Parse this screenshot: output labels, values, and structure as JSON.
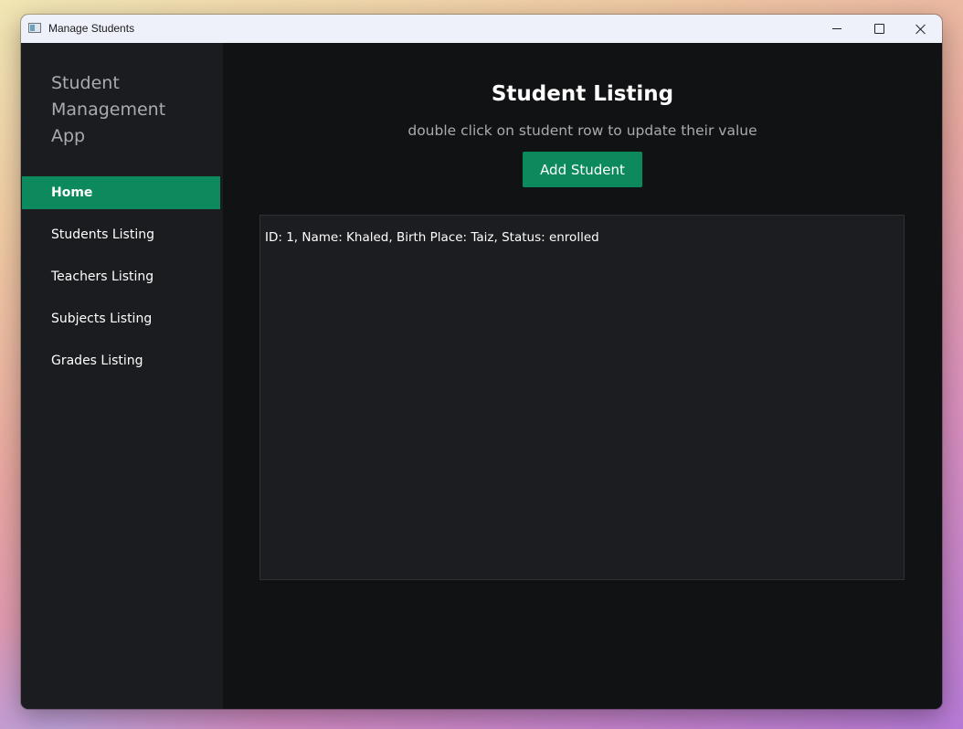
{
  "window": {
    "title": "Manage Students"
  },
  "sidebar": {
    "app_title": "Student Management App",
    "items": [
      {
        "label": "Home",
        "active": true
      },
      {
        "label": "Students Listing",
        "active": false
      },
      {
        "label": "Teachers Listing",
        "active": false
      },
      {
        "label": "Subjects Listing",
        "active": false
      },
      {
        "label": "Grades Listing",
        "active": false
      }
    ]
  },
  "main": {
    "title": "Student Listing",
    "subtitle": "double click on student row to update their value",
    "add_button_label": "Add Student",
    "students": [
      {
        "text": "ID: 1, Name: Khaled, Birth Place: Taiz, Status: enrolled"
      }
    ]
  },
  "colors": {
    "accent": "#0d8a5d",
    "sidebar_bg": "#1b1c20",
    "main_bg": "#111214",
    "list_bg": "#1c1d21"
  },
  "icons": {
    "app": "app-window-icon",
    "minimize": "minimize-icon",
    "maximize": "maximize-icon",
    "close": "close-icon"
  }
}
